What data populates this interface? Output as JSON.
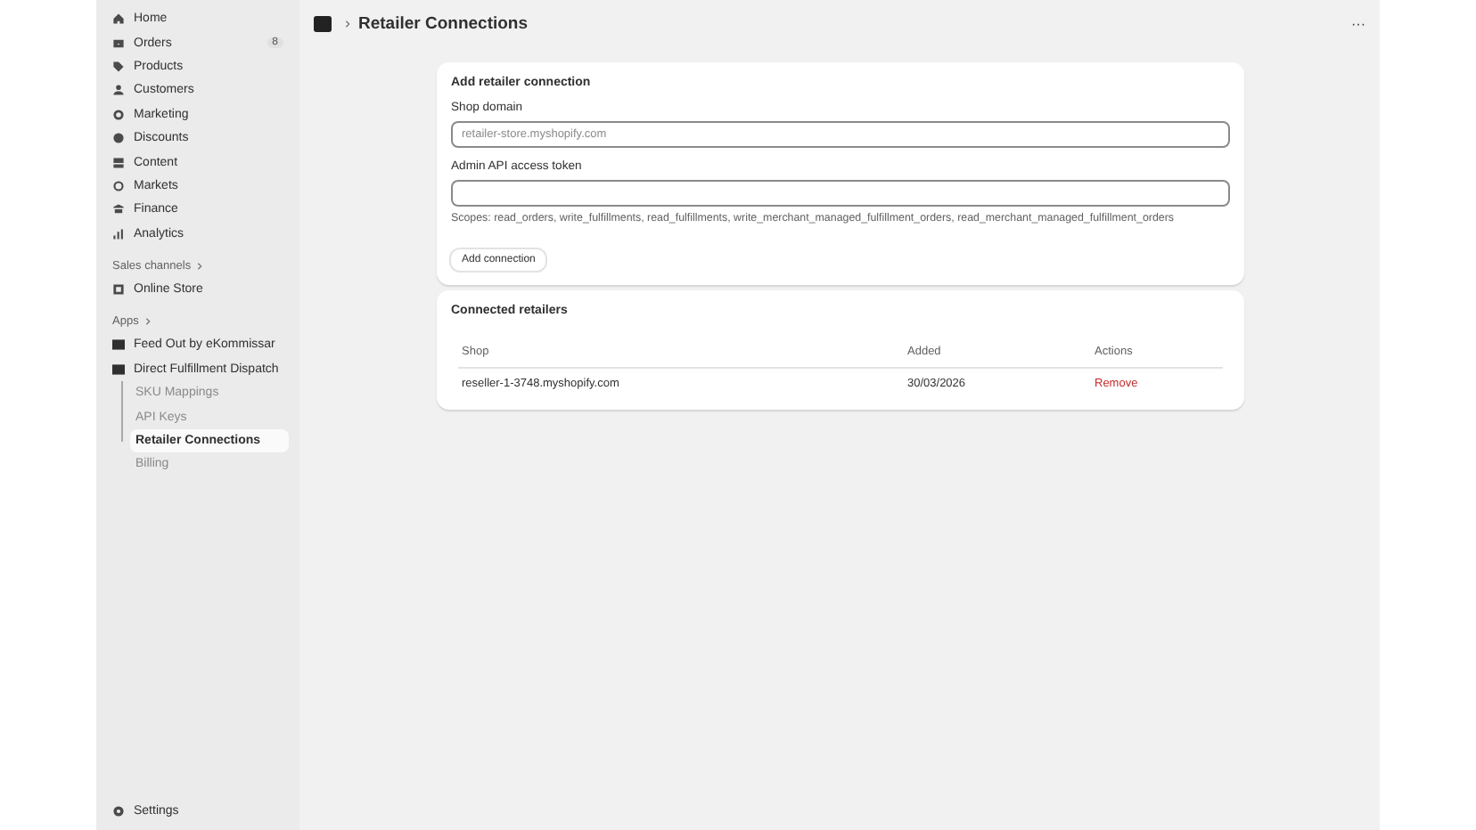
{
  "sidebar": {
    "items": [
      {
        "label": "Home",
        "selected": false
      },
      {
        "label": "Orders",
        "selected": false,
        "badge": "8"
      },
      {
        "label": "Products",
        "selected": false
      },
      {
        "label": "Customers",
        "selected": false
      },
      {
        "label": "Marketing",
        "selected": false
      },
      {
        "label": "Discounts",
        "selected": false
      },
      {
        "label": "Content",
        "selected": false
      },
      {
        "label": "Markets",
        "selected": false
      },
      {
        "label": "Finance",
        "selected": false
      },
      {
        "label": "Analytics",
        "selected": false
      }
    ],
    "sales_channels": {
      "title": "Sales channels",
      "items": [
        {
          "label": "Online Store",
          "selected": false
        }
      ]
    },
    "apps": {
      "title": "Apps",
      "items": [
        {
          "label": "Feed Out by eKommissar",
          "selected": false
        },
        {
          "label": "Direct Fulfillment Dispatch",
          "selected": false,
          "children": [
            {
              "label": "SKU Mappings",
              "selected": false
            },
            {
              "label": "API Keys",
              "selected": false
            },
            {
              "label": "Retailer Connections",
              "selected": true
            },
            {
              "label": "Billing",
              "selected": false
            }
          ]
        }
      ]
    },
    "settings": {
      "label": "Settings"
    }
  },
  "header": {
    "title": "Retailer Connections",
    "menu": "···"
  },
  "add_card": {
    "title": "Add retailer connection",
    "fields": [
      {
        "label": "Shop domain",
        "placeholder": "retailer-store.myshopify.com"
      },
      {
        "label": "Admin API access token"
      }
    ],
    "help": "Scopes: read_orders, write_fulfillments, read_fulfillments, write_merchant_managed_fulfillment_orders, read_merchant_managed_fulfillment_orders",
    "button": "Add connection"
  },
  "retailers_card": {
    "title": "Connected retailers",
    "columns": [
      "Shop",
      "Added",
      "Actions"
    ],
    "rows": [
      {
        "shop": "reseller-1-3748.myshopify.com",
        "added": "30/03/2026",
        "action": "Remove"
      }
    ]
  }
}
